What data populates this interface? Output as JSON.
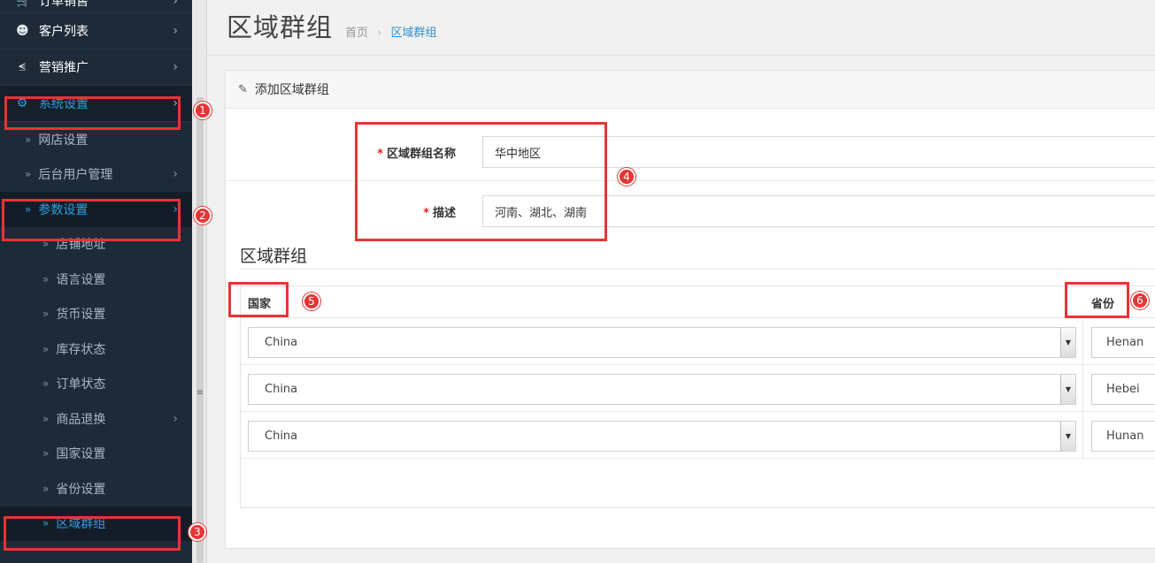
{
  "sidebar": {
    "items": [
      {
        "label": "订单销售",
        "icon": "cart-icon"
      },
      {
        "label": "客户列表",
        "icon": "user-icon"
      },
      {
        "label": "营销推广",
        "icon": "share-icon"
      },
      {
        "label": "系统设置",
        "icon": "gear-icon"
      }
    ],
    "sub_items": [
      {
        "label": "网店设置"
      },
      {
        "label": "后台用户管理"
      },
      {
        "label": "参数设置"
      }
    ],
    "param_items": [
      {
        "label": "店铺地址"
      },
      {
        "label": "语言设置"
      },
      {
        "label": "货币设置"
      },
      {
        "label": "库存状态"
      },
      {
        "label": "订单状态"
      },
      {
        "label": "商品退换"
      },
      {
        "label": "国家设置"
      },
      {
        "label": "省份设置"
      },
      {
        "label": "区域群组"
      }
    ]
  },
  "header": {
    "title": "区域群组",
    "breadcrumb_home": "首页",
    "breadcrumb_sep": "›",
    "breadcrumb_current": "区域群组"
  },
  "panel": {
    "title": "添加区域群组",
    "name_label": "区域群组名称",
    "name_value": "华中地区",
    "desc_label": "描述",
    "desc_value": "河南、湖北、湖南",
    "required_mark": "*"
  },
  "zone_section": {
    "title": "区域群组",
    "col_country": "国家",
    "col_province": "省份",
    "rows": [
      {
        "country": "China",
        "province": "Henan"
      },
      {
        "country": "China",
        "province": "Hebei"
      },
      {
        "country": "China",
        "province": "Hunan"
      }
    ]
  },
  "annotations": [
    "1",
    "2",
    "3",
    "4",
    "5",
    "6"
  ],
  "colors": {
    "sidebar_bg": "#1e2a38",
    "accent": "#2d9fe0",
    "annotation": "#e53535"
  }
}
